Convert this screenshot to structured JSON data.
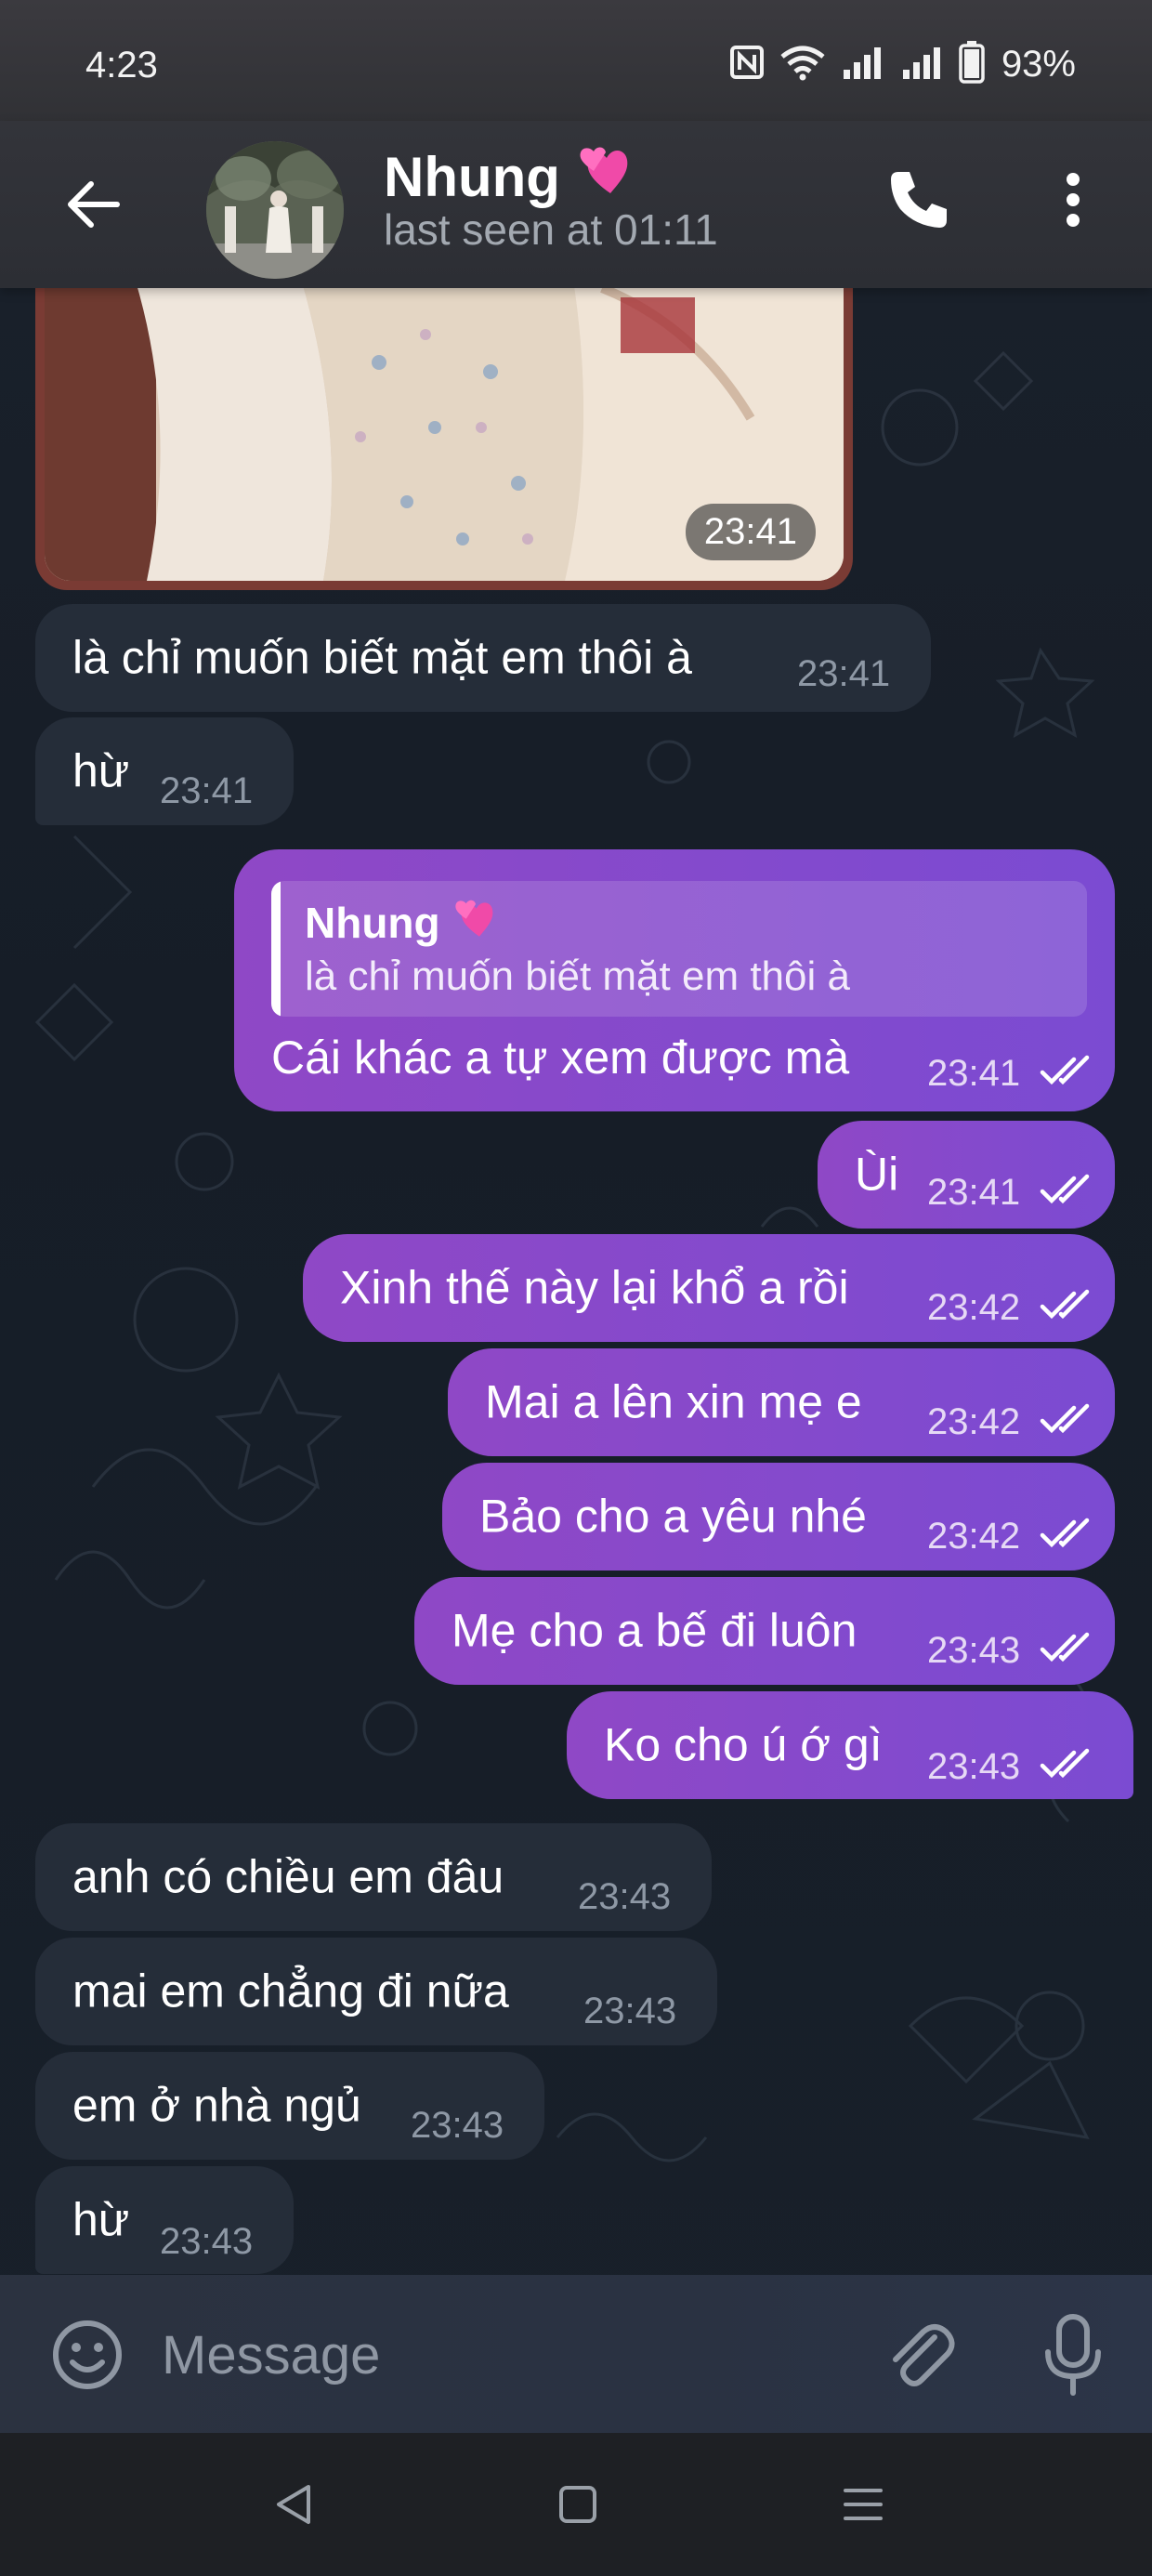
{
  "status_bar": {
    "time": "4:23",
    "battery": "93%"
  },
  "header": {
    "contact_name": "Nhung",
    "contact_emoji": "💕",
    "last_seen": "last seen at 01:11"
  },
  "photo_message": {
    "time": "23:41"
  },
  "messages": [
    {
      "direction": "in",
      "text": "là chỉ muốn biết mặt em thôi à",
      "time": "23:41"
    },
    {
      "direction": "in",
      "text": "hừ",
      "time": "23:41"
    },
    {
      "direction": "out",
      "text": "Cái khác a tự xem được mà",
      "time": "23:41",
      "reply": {
        "name": "Nhung",
        "emoji": "💕",
        "text": "là chỉ muốn biết mặt em thôi à"
      }
    },
    {
      "direction": "out",
      "text": "Ùi",
      "time": "23:41"
    },
    {
      "direction": "out",
      "text": "Xinh thế này lại khổ a rồi",
      "time": "23:42"
    },
    {
      "direction": "out",
      "text": "Mai a lên xin mẹ e",
      "time": "23:42"
    },
    {
      "direction": "out",
      "text": "Bảo cho a yêu nhé",
      "time": "23:42"
    },
    {
      "direction": "out",
      "text": "Mẹ cho a bế đi luôn",
      "time": "23:43"
    },
    {
      "direction": "out",
      "text": "Ko cho ú ớ gì",
      "time": "23:43"
    },
    {
      "direction": "in",
      "text": "anh có chiều em đâu",
      "time": "23:43"
    },
    {
      "direction": "in",
      "text": "mai em chẳng đi nữa",
      "time": "23:43"
    },
    {
      "direction": "in",
      "text": "em ở nhà ngủ",
      "time": "23:43"
    },
    {
      "direction": "in",
      "text": "hừ",
      "time": "23:43"
    }
  ],
  "composer": {
    "placeholder": "Message"
  },
  "colors": {
    "outgoing_bubble": "#8a49c9",
    "incoming_bubble": "#252d39",
    "background": "#161d27"
  },
  "icons": {
    "back": "arrow-left-icon",
    "call": "phone-icon",
    "menu": "more-vertical-icon",
    "emoji": "smiley-icon",
    "attach": "paperclip-icon",
    "mic": "microphone-icon",
    "read": "double-check-icon"
  }
}
